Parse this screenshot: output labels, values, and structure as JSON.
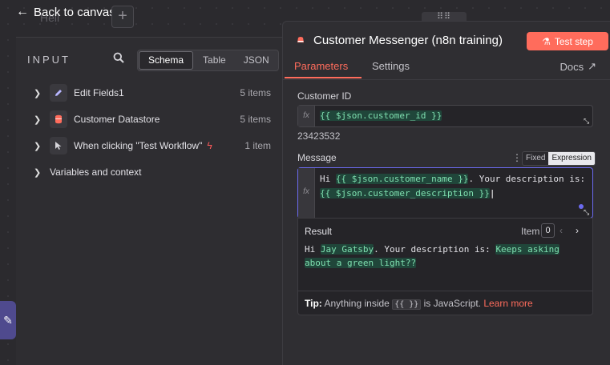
{
  "header": {
    "back_label": "Back to canvas",
    "ghost_text": "Hell",
    "plus_label": "+",
    "drag_label": "⠿⠿"
  },
  "input": {
    "title": "INPUT",
    "views": [
      "Schema",
      "Table",
      "JSON"
    ],
    "active_view": "Schema",
    "nodes": [
      {
        "label": "Edit Fields1",
        "count": "5 items",
        "icon": "pencil-icon"
      },
      {
        "label": "Customer Datastore",
        "count": "5 items",
        "icon": "database-icon"
      },
      {
        "label": "When clicking \"Test Workflow\"",
        "count": "1 item",
        "icon": "pointer-icon"
      }
    ],
    "variables_label": "Variables and context"
  },
  "node": {
    "title": "Customer Messenger (n8n training)",
    "test_button": "Test step",
    "tabs": [
      "Parameters",
      "Settings"
    ],
    "docs_label": "Docs",
    "customer_id": {
      "label": "Customer ID",
      "expression": "{{ $json.customer_id }}",
      "value": "23423532"
    },
    "message": {
      "label": "Message",
      "mode_fixed": "Fixed",
      "mode_expression": "Expression",
      "prefix": "Hi ",
      "expr1": "{{ $json.customer_name }}",
      "middle": ". Your description is:",
      "expr2": "{{ $json.customer_description }}"
    },
    "result": {
      "label": "Result",
      "item_label": "Item",
      "item_index": "0",
      "prefix": "Hi ",
      "name": "Jay Gatsby",
      "middle": ". Your description is: ",
      "desc_line1": "Keeps asking",
      "desc_line2": "about a green light??"
    },
    "tip": {
      "bold": "Tip:",
      "text1": " Anything inside ",
      "code": "{{ }}",
      "text2": " is JavaScript. ",
      "link": "Learn more"
    }
  },
  "colors": {
    "accent": "#ff6c5c",
    "expression_bg": "#20463a",
    "expression_fg": "#7fe0b0",
    "focus": "#6b6af0"
  }
}
